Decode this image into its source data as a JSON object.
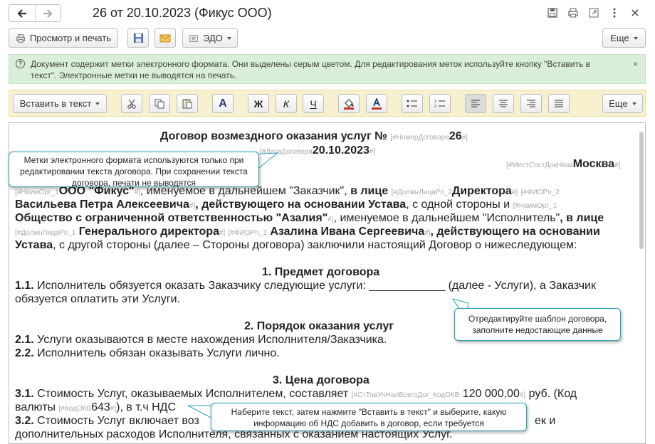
{
  "window": {
    "title": "26 от 20.10.2023 (Фикус ООО)"
  },
  "command_bar": {
    "print_preview": "Просмотр и печать",
    "edo": "ЭДО",
    "more": "Еще"
  },
  "info_banner": {
    "text": "Документ содержит метки электронного формата. Они выделены серым цветом. Для редактирования меток используйте кнопку \"Вставить в текст\". Электронные метки не выводятся на печать.",
    "close": "×"
  },
  "format_toolbar": {
    "insert_label": "Вставить в текст",
    "bold": "Ж",
    "italic": "К",
    "underline": "Ч",
    "font": "A",
    "more": "Еще"
  },
  "document": {
    "title_pre": "Договор возмездного оказания услуг №",
    "m_number": "[#НомерДоговора",
    "number": "26",
    "m_close": "#]",
    "m_date": "[#ДатаДоговора",
    "date": "20.10.2023",
    "m_place": "[#МестСостДокНазв",
    "city": "Москва",
    "l1_m_org": "[#НаимОрг_1",
    "l1_org": "ООО \"Фикус\"",
    "l1_rest": ", именуемое в дальнейшем \"Заказчик\",",
    "l1_b": " в лице",
    "l1_m_pos": "[#ДолжнЛицаРп_2",
    "l1_pos": "Директора",
    "l1_m_fio": "[#ФИОРп_2",
    "l2_fio": "Васильева Петра Алексеевича",
    "l2_rest": ", действующего на основании Устава",
    "l2_tail": ", с одной стороны и",
    "l2_m_org": "[#НаимОрг_1",
    "l3_org": "Общество с ограниченной ответственностью \"Азалия\"",
    "l3_rest": ", именуемое в дальнейшем \"Исполнитель\"",
    "l3_b": ", в лице",
    "l4_m_pos": "[#ДолжнЛицаРп_1",
    "l4_pos": "Генерального директора",
    "l4_m_fio": "[#ФИОРп_1",
    "l4_fio": "Азалина Ивана Сергеевича",
    "l4_rest": ", действующего на основании",
    "l5_b": "Устава",
    "l5_rest": ", с другой стороны (далее – Стороны договора) заключили настоящий Договор о нижеследующем:",
    "s1_head": "1. Предмет договора",
    "p11_num": "1.1.",
    "p11_text": " Исполнитель обязуется оказать Заказчику следующие услуги: ____________ (далее - Услуги), а Заказчик",
    "p11_cont": "обязуется оплатить эти Услуги.",
    "s2_head": "2. Порядок оказания услуг",
    "p21_num": "2.1.",
    "p21_text": " Услуги оказываются в месте нахождения Исполнителя/Заказчика.",
    "p22_num": "2.2.",
    "p22_text": " Исполнитель обязан оказывать Услуги лично.",
    "s3_head": "3. Цена договора",
    "p31_num": "3.1.",
    "p31_text": " Стоимость Услуг, оказываемых Исполнителем, составляет",
    "p31_m": "[#СтТовУчНалВсегоДог_КодОКВ",
    "p31_val": "120 000,00",
    "p31_tail": " руб. (Код",
    "p31b_text": "валюты",
    "p31b_m": "[#КодОКВ",
    "p31b_val": "643",
    "p31b_tail": "), в т.ч НДС",
    "p32_num": "3.2.",
    "p32_text": " Стоимость Услуг включает воз",
    "p32_tail": "ек и",
    "p32b_text": "дополнительных расходов Исполнителя, связанных с оказанием настоящих Услуг."
  },
  "callouts": {
    "marks": "Метки электронного формата используются только при редактировании текста договора. При сохранении текста договора, печати не выводятся",
    "template": "Отредактируйте шаблон договора, заполните недостающие данные",
    "vat": "Наберите текст, затем нажмите \"Вставить в текст\" и выберите, какую информацию об НДС добавить в договор, если требуется"
  },
  "colors": {
    "info_bg": "#d9efd7",
    "toolbar_bg": "#f7f1cf",
    "callout_border": "#27a0ba",
    "mark_gray": "#a8a8a8"
  }
}
